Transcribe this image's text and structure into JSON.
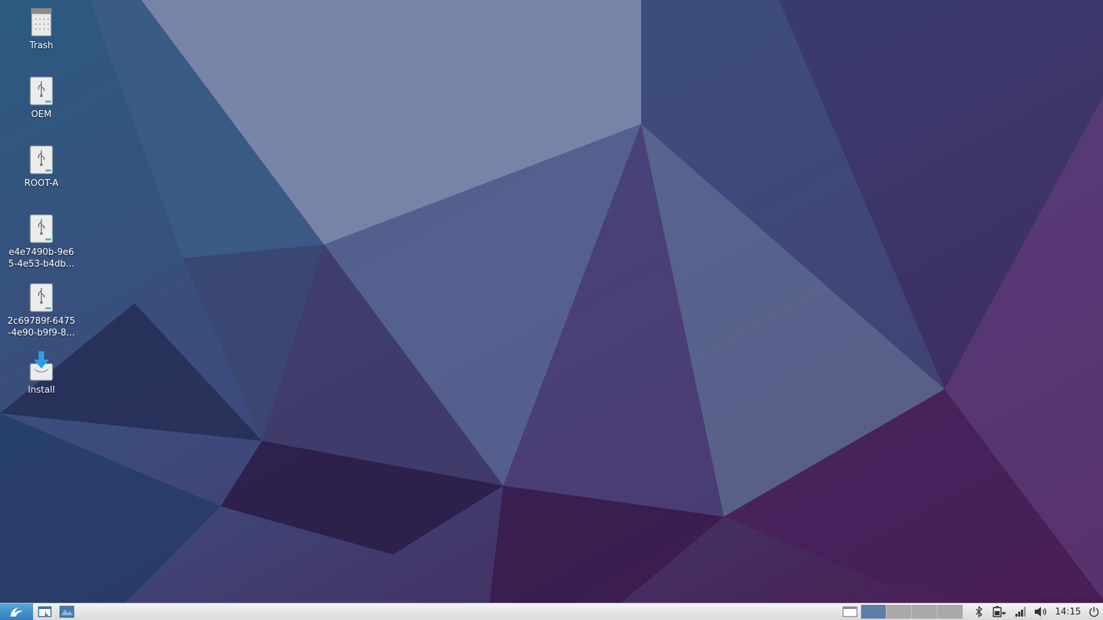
{
  "desktop": {
    "icons": [
      {
        "label": "Trash",
        "icon": "trash-icon"
      },
      {
        "label": "OEM",
        "icon": "usb-drive-icon"
      },
      {
        "label": "ROOT-A",
        "icon": "usb-drive-icon"
      },
      {
        "label": "e4e7490b-9e6 5-4e53-b4db...",
        "icon": "usb-drive-icon"
      },
      {
        "label": "2c69789f-6475-4e90-b9f9-8...",
        "icon": "usb-drive-icon"
      },
      {
        "label": "Install",
        "icon": "install-icon"
      }
    ]
  },
  "taskbar": {
    "clock": "14:15",
    "workspaces": 4,
    "active_workspace": 1,
    "tray_icons": [
      "bluetooth-icon",
      "battery-icon",
      "network-signal-icon",
      "volume-icon",
      "power-icon"
    ]
  },
  "colors": {
    "accent": "#5c7ea8",
    "taskbar": "#e6e6e6"
  }
}
